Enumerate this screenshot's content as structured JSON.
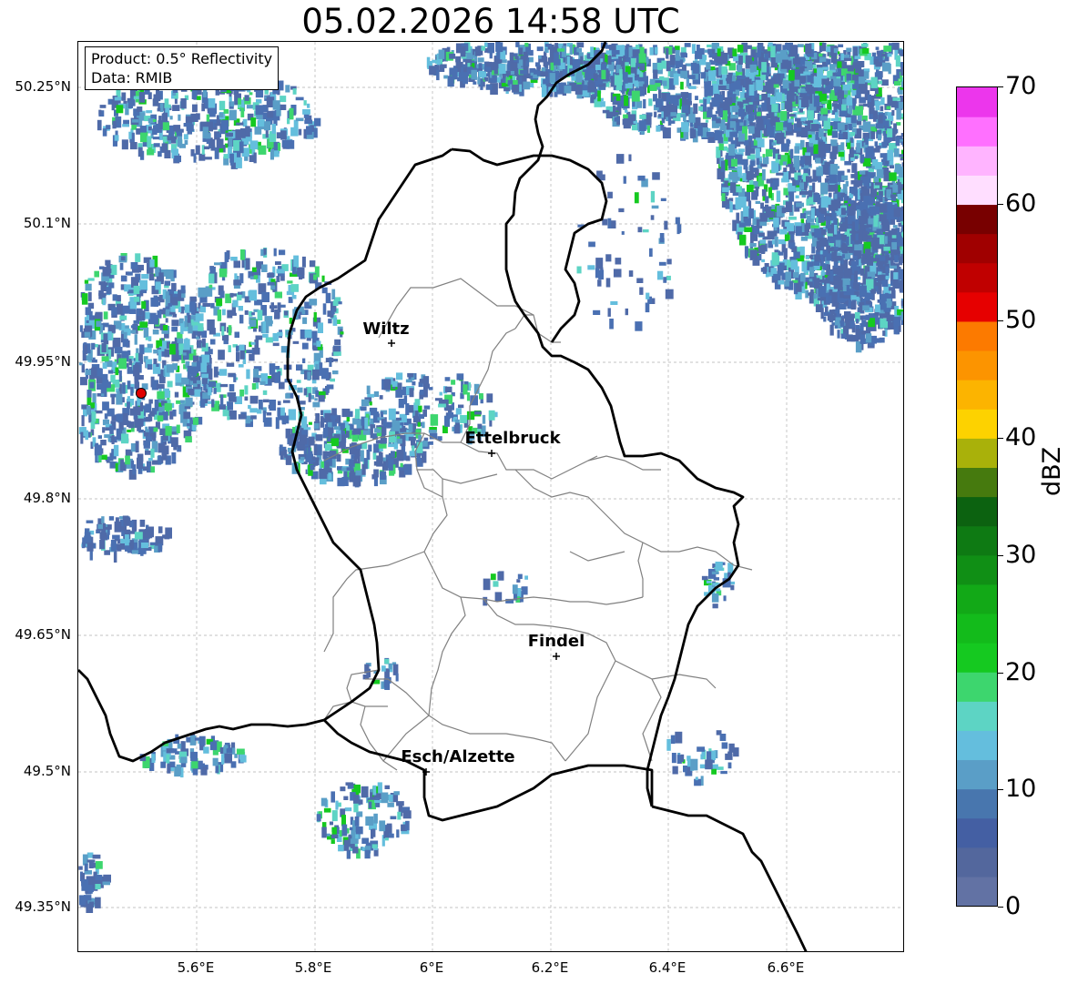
{
  "title": "05.02.2026 14:58 UTC",
  "info": {
    "line1": "Product: 0.5° Reflectivity",
    "line2": "Data: RMIB"
  },
  "lat_labels": [
    "50.25°N",
    "50.1°N",
    "49.95°N",
    "49.8°N",
    "49.65°N",
    "49.5°N",
    "49.35°N"
  ],
  "lon_labels": [
    "5.6°E",
    "5.8°E",
    "6°E",
    "6.2°E",
    "6.4°E",
    "6.6°E"
  ],
  "cities": [
    {
      "name": "Wiltz"
    },
    {
      "name": "Ettelbruck"
    },
    {
      "name": "Findel"
    },
    {
      "name": "Esch/Alzette"
    }
  ],
  "colorbar": {
    "label": "dBZ",
    "ticks": [
      "0",
      "10",
      "20",
      "30",
      "40",
      "50",
      "60",
      "70"
    ],
    "range": [
      0,
      70
    ],
    "colors": [
      "#6272a4",
      "#53679d",
      "#445fa3",
      "#4876ae",
      "#5a9ec7",
      "#64bedd",
      "#5dd4c4",
      "#3dd66e",
      "#15c920",
      "#13bb1b",
      "#12a917",
      "#108f15",
      "#0e7a13",
      "#0c6210",
      "#467a0e",
      "#a9b10a",
      "#fdd200",
      "#fcb400",
      "#fc9400",
      "#fc7a00",
      "#e60000",
      "#c00000",
      "#a00000",
      "#780000",
      "#ffdeff",
      "#ffb4ff",
      "#ff70ff",
      "#ec36ec"
    ]
  },
  "colors": {
    "border": "#000000",
    "district": "#808080",
    "grid": "#b0b0b0",
    "radar_site": "#e00000"
  }
}
